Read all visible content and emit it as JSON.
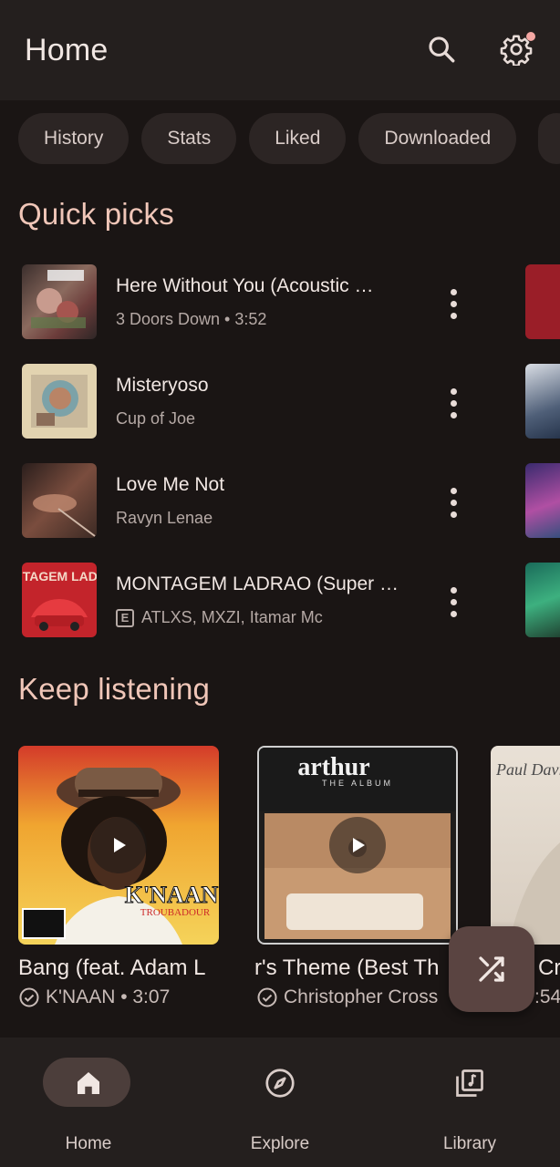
{
  "app": {
    "title": "Home"
  },
  "chips": [
    "History",
    "Stats",
    "Liked",
    "Downloaded"
  ],
  "sections": {
    "quick_picks": "Quick picks",
    "keep_listening": "Keep listening"
  },
  "quick_picks": [
    {
      "title": "Here Without You (Acoustic …",
      "subtitle": "3 Doors Down • 3:52",
      "explicit": false,
      "art_color": "#6b4b4a"
    },
    {
      "title": "Misteryoso",
      "subtitle": "Cup of Joe",
      "explicit": false,
      "art_color": "#cbb894"
    },
    {
      "title": "Love Me Not",
      "subtitle": "Ravyn Lenae",
      "explicit": false,
      "art_color": "#5a3a32"
    },
    {
      "title": "MONTAGEM LADRAO (Super …",
      "subtitle": "ATLXS, MXZI, Itamar Mc",
      "explicit": true,
      "explicit_label": "E",
      "art_color": "#c3242b"
    }
  ],
  "keep_listening": [
    {
      "title": "Bang (feat. Adam L",
      "subtitle": "K'NAAN • 3:07"
    },
    {
      "title": "r's Theme (Best Th",
      "subtitle": "Christopher Cross"
    },
    {
      "title": "Cr",
      "subtitle": ":54"
    }
  ],
  "album_art_text": {
    "card1": "K'NAAN",
    "card1_sub": "TROUBADOUR",
    "card2": "arthur",
    "card2_sub": "THE ALBUM",
    "card3": "Paul Davis",
    "montagem": "MONTAGEM LADRAO"
  },
  "nav": [
    {
      "label": "Home",
      "icon": "home-icon",
      "active": true
    },
    {
      "label": "Explore",
      "icon": "compass-icon",
      "active": false
    },
    {
      "label": "Library",
      "icon": "library-icon",
      "active": false
    }
  ],
  "colors": {
    "background": "#1a1514",
    "surface": "#241f1e",
    "accent": "#f0c6b8",
    "fab": "#5a4441"
  }
}
